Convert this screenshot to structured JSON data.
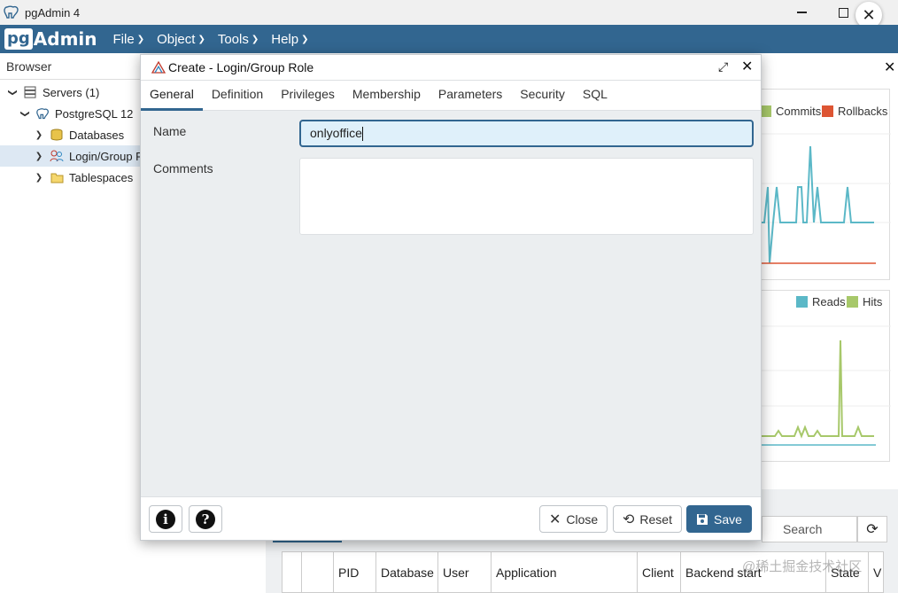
{
  "window": {
    "title": "pgAdmin 4",
    "minimize_icon": "minimize-icon",
    "maximize_icon": "maximize-icon",
    "close_label": "✕"
  },
  "menubar": {
    "logo_pg": "pg",
    "logo_admin": "Admin",
    "items": [
      {
        "label": "File"
      },
      {
        "label": "Object"
      },
      {
        "label": "Tools"
      },
      {
        "label": "Help"
      }
    ],
    "bg_color": "#326690"
  },
  "browser": {
    "title": "Browser",
    "tree": [
      {
        "label": "Servers (1)",
        "icon": "servers-icon",
        "expanded": true
      },
      {
        "label": "PostgreSQL 12",
        "icon": "postgres-elephant-icon",
        "expanded": true
      },
      {
        "label": "Databases",
        "icon": "databases-icon",
        "expanded": false
      },
      {
        "label": "Login/Group R",
        "icon": "login-role-icon",
        "expanded": false,
        "selected": true
      },
      {
        "label": "Tablespaces",
        "icon": "tablespaces-icon",
        "expanded": false
      }
    ]
  },
  "dashboard": {
    "close_label": "✕",
    "legend_top": [
      {
        "label": "Commits",
        "color": "#a7c86a"
      },
      {
        "label": "Rollbacks",
        "color": "#dd5533"
      }
    ],
    "legend_bottom": [
      {
        "label": "Reads",
        "color": "#5bb8c7"
      },
      {
        "label": "Hits",
        "color": "#a7c86a"
      }
    ],
    "search_placeholder": "Search",
    "table_columns": [
      "",
      "",
      "PID",
      "Database",
      "User",
      "Application",
      "Client",
      "Backend start",
      "State",
      "V"
    ]
  },
  "dialog": {
    "title": "Create - Login/Group Role",
    "tabs": [
      "General",
      "Definition",
      "Privileges",
      "Membership",
      "Parameters",
      "Security",
      "SQL"
    ],
    "active_tab": "General",
    "fields": {
      "name_label": "Name",
      "name_value": "onlyoffice",
      "comments_label": "Comments",
      "comments_value": ""
    },
    "footer": {
      "info_label": "i",
      "help_label": "?",
      "close_label": "Close",
      "reset_label": "Reset",
      "save_label": "Save"
    }
  },
  "watermark": "@稀土掘金技术社区"
}
